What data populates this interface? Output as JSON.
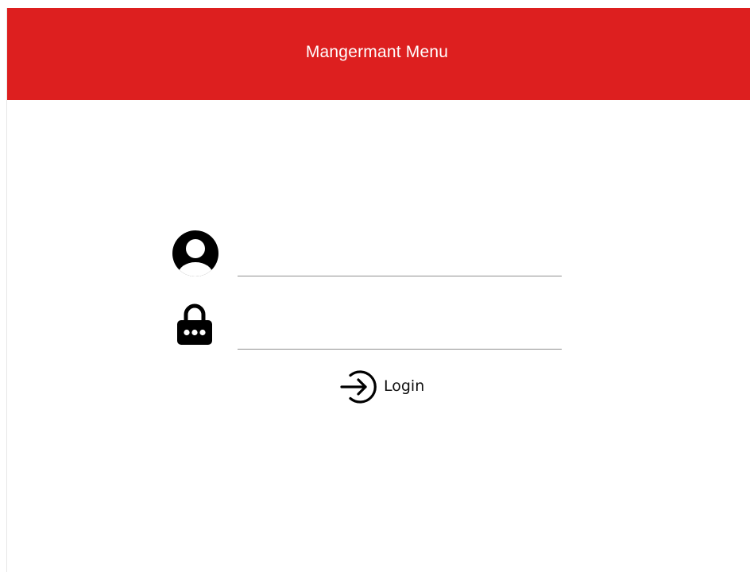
{
  "header": {
    "title": "Mangermant Menu",
    "background_color": "#dd1f1f",
    "text_color": "#ffffff"
  },
  "login_form": {
    "username": {
      "icon": "user-avatar-icon",
      "value": "",
      "placeholder": ""
    },
    "password": {
      "icon": "lock-icon",
      "value": "",
      "placeholder": ""
    },
    "submit": {
      "icon": "login-arrow-icon",
      "label": "Login"
    }
  }
}
